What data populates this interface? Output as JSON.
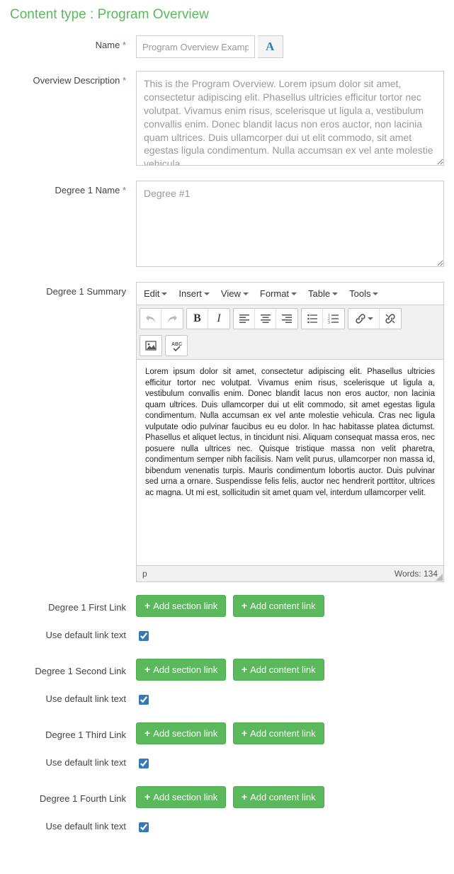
{
  "pageTitle": "Content type : Program Overview",
  "labels": {
    "name": "Name",
    "overviewDescription": "Overview Description",
    "degree1Name": "Degree 1 Name",
    "degree1Summary": "Degree 1 Summary",
    "degree1FirstLink": "Degree 1 First Link",
    "degree1SecondLink": "Degree 1 Second Link",
    "degree1ThirdLink": "Degree 1 Third Link",
    "degree1FourthLink": "Degree 1 Fourth Link",
    "useDefaultLinkText": "Use default link text"
  },
  "values": {
    "name": "Program Overview Example",
    "overviewDescription": "This is the Program Overview. Lorem ipsum dolor sit amet, consectetur adipiscing elit. Phasellus ultricies efficitur tortor nec volutpat. Vivamus enim risus, scelerisque ut ligula a, vestibulum convallis enim. Donec blandit lacus non eros auctor, non lacinia quam ultrices. Duis ullamcorper dui ut elit commodo, sit amet egestas ligula condimentum. Nulla accumsan ex vel ante molestie vehicula.",
    "degree1Name": "Degree #1",
    "degree1Summary": "Lorem ipsum dolor sit amet, consectetur adipiscing elit. Phasellus ultricies efficitur tortor nec volutpat. Vivamus enim risus, scelerisque ut ligula a, vestibulum convallis enim. Donec blandit lacus non eros auctor, non lacinia quam ultrices. Duis ullamcorper dui ut elit commodo, sit amet egestas ligula condimentum. Nulla accumsan ex vel ante molestie vehicula. Cras nec ligula vulputate odio pulvinar faucibus eu eu dolor. In hac habitasse platea dictumst. Phasellus et aliquet lectus, in tincidunt nisi. Aliquam consequat massa eros, nec posuere nulla ultrices nec. Quisque tristique massa non velit pharetra, condimentum semper nibh facilisis. Nam velit purus, ullamcorper non massa id, bibendum venenatis turpis. Mauris condimentum lobortis auctor. Duis pulvinar sed urna a ornare. Suspendisse felis felis, auctor nec hendrerit porttitor, ultrices ac magna. Ut mi est, sollicitudin sit amet quam vel, interdum ullamcorper velit."
  },
  "editor": {
    "menus": {
      "edit": "Edit",
      "insert": "Insert",
      "view": "View",
      "format": "Format",
      "table": "Table",
      "tools": "Tools"
    },
    "statusPath": "p",
    "wordCountLabel": "Words: 134"
  },
  "buttons": {
    "addSectionLink": "Add section link",
    "addContentLink": "Add content link"
  },
  "checkboxes": {
    "link1Default": true,
    "link2Default": true,
    "link3Default": true,
    "link4Default": true
  },
  "langIndicator": "A"
}
